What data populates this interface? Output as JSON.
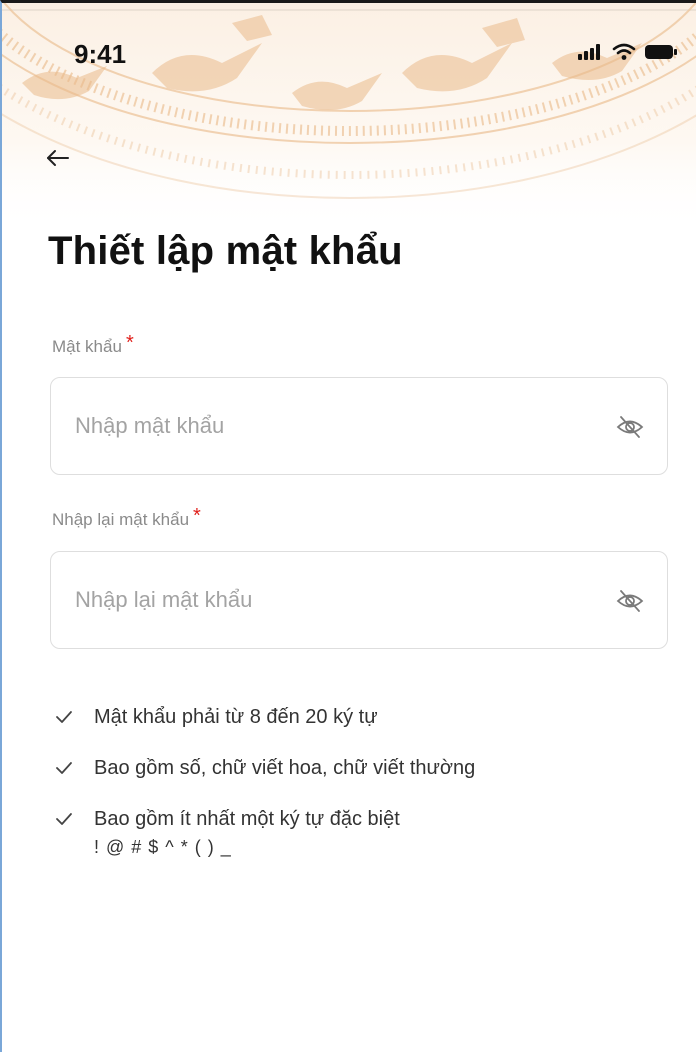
{
  "status_bar": {
    "time": "9:41",
    "icons": [
      "signal-icon",
      "wifi-icon",
      "battery-icon"
    ]
  },
  "nav": {
    "back_icon": "arrow-left-icon"
  },
  "page": {
    "title": "Thiết lập mật khẩu"
  },
  "form": {
    "password": {
      "label": "Mật khẩu",
      "required_mark": "*",
      "placeholder": "Nhập mật khẩu",
      "value": "",
      "toggle_icon": "eye-off-icon"
    },
    "confirm_password": {
      "label": "Nhập lại mật khẩu",
      "required_mark": "*",
      "placeholder": "Nhập lại mật khẩu",
      "value": "",
      "toggle_icon": "eye-off-icon"
    }
  },
  "rules": [
    {
      "text": "Mật khẩu phải từ 8 đến 20 ký tự",
      "icon": "check-icon"
    },
    {
      "text": "Bao gồm số, chữ viết hoa, chữ viết thường",
      "icon": "check-icon"
    },
    {
      "text": "Bao gồm ít nhất một ký tự đặc biệt",
      "subtext": "! @ # $ ^ * ( ) _",
      "icon": "check-icon"
    }
  ],
  "colors": {
    "accent_required": "#e0201b",
    "header_pattern": "#e7b98a",
    "input_border": "#dedede",
    "placeholder": "#a3a3a3"
  }
}
